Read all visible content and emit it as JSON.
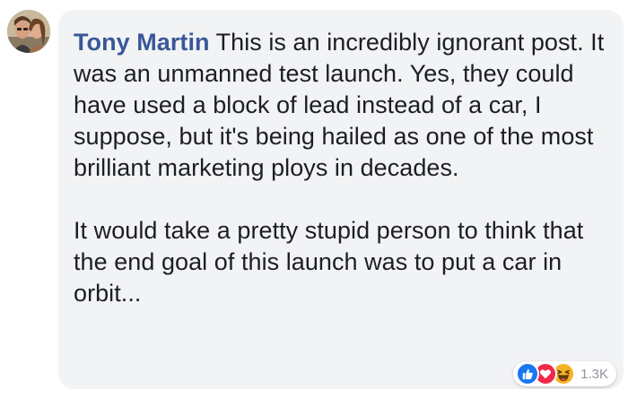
{
  "comment": {
    "author": "Tony Martin",
    "paragraphs": [
      "This is an incredibly ignorant post. It was an unmanned test launch. Yes, they could have used a block of lead instead of a car, I suppose, but it's being hailed as one of the most brilliant marketing ploys in decades.",
      "It would take a pretty stupid person to think that the end goal of this launch was to put a car in orbit..."
    ]
  },
  "reactions": {
    "icons": [
      "like-icon",
      "love-icon",
      "haha-icon"
    ],
    "count": "1.3K"
  },
  "colors": {
    "author": "#385898",
    "bubble": "#f2f3f5",
    "text": "#1c1e21",
    "like": "#1877f2",
    "love": "#f0284a",
    "haha": "#f7b125"
  }
}
